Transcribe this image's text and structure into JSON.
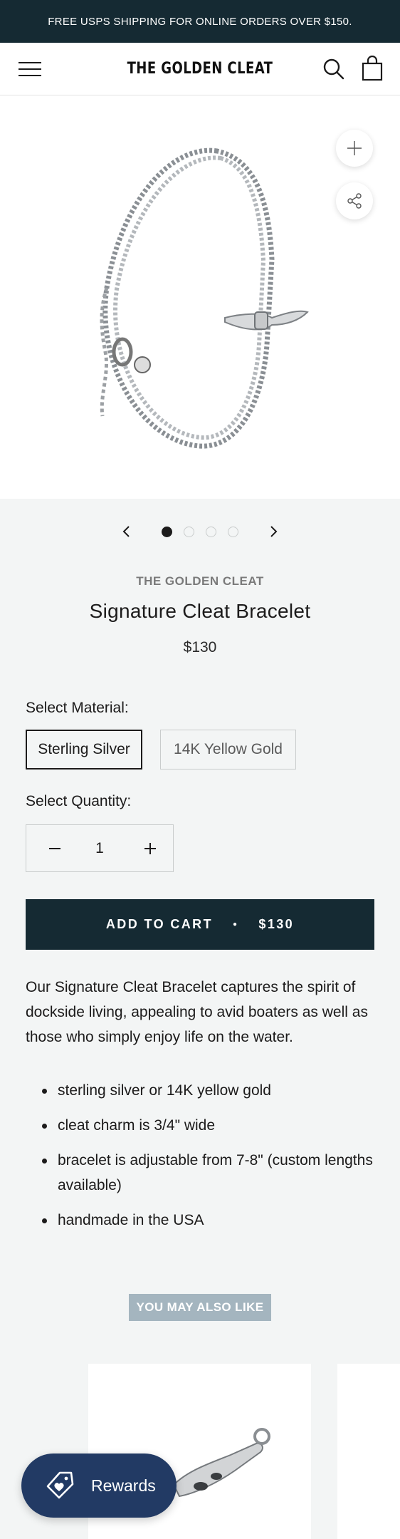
{
  "announcement": "FREE USPS SHIPPING FOR ONLINE ORDERS OVER $150.",
  "header": {
    "logo": "THE GOLDEN CLEAT"
  },
  "gallery": {
    "slides": 4,
    "active_slide": 1
  },
  "product": {
    "vendor": "THE GOLDEN CLEAT",
    "title": "Signature Cleat Bracelet",
    "price": "$130",
    "material_label": "Select Material:",
    "materials": [
      "Sterling Silver",
      "14K Yellow Gold"
    ],
    "selected_material": "Sterling Silver",
    "quantity_label": "Select Quantity:",
    "quantity": "1",
    "add_to_cart": {
      "label": "ADD TO CART",
      "price": "$130"
    },
    "description": "Our Signature Cleat Bracelet captures the spirit of dockside living, appealing to avid boaters as well as those who simply enjoy life on the water.",
    "features": [
      "sterling silver or 14K yellow gold",
      "cleat charm is 3/4\" wide",
      "bracelet is adjustable from 7-8\" (custom lengths available)",
      "handmade in the USA"
    ]
  },
  "recommendations": {
    "heading": "YOU MAY ALSO LIKE"
  },
  "rewards": {
    "label": "Rewards"
  },
  "colors": {
    "dark": "#152a33",
    "rewards": "#223a64",
    "tag": "#a4b5bf",
    "background": "#f3f5f5"
  }
}
